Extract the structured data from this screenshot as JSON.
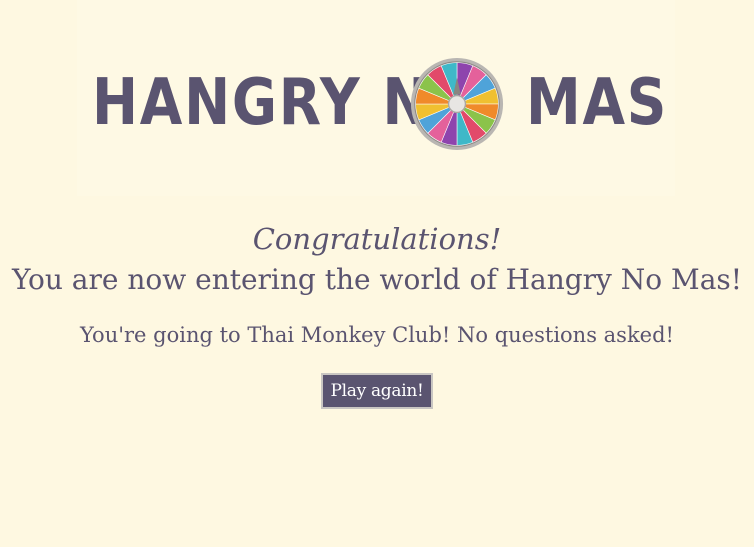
{
  "logo": {
    "left_text": "HANGRY N",
    "right_text": "MAS",
    "wheel_icon": "prize-wheel-icon",
    "wheel_colors": [
      "#8e44ad",
      "#e4619b",
      "#4fa3d9",
      "#f0c030",
      "#f08a2a",
      "#8bc34a",
      "#e24a6a",
      "#3fb8c8"
    ]
  },
  "message": {
    "congrats": "Congratulations!",
    "entering": "You are now entering the world of Hangry No Mas!",
    "destination": "You're going to Thai Monkey Club! No questions asked!"
  },
  "actions": {
    "play_again_label": "Play again!"
  },
  "colors": {
    "background": "#fef8e1",
    "text": "#5a5470",
    "button_bg": "#5a5470"
  }
}
